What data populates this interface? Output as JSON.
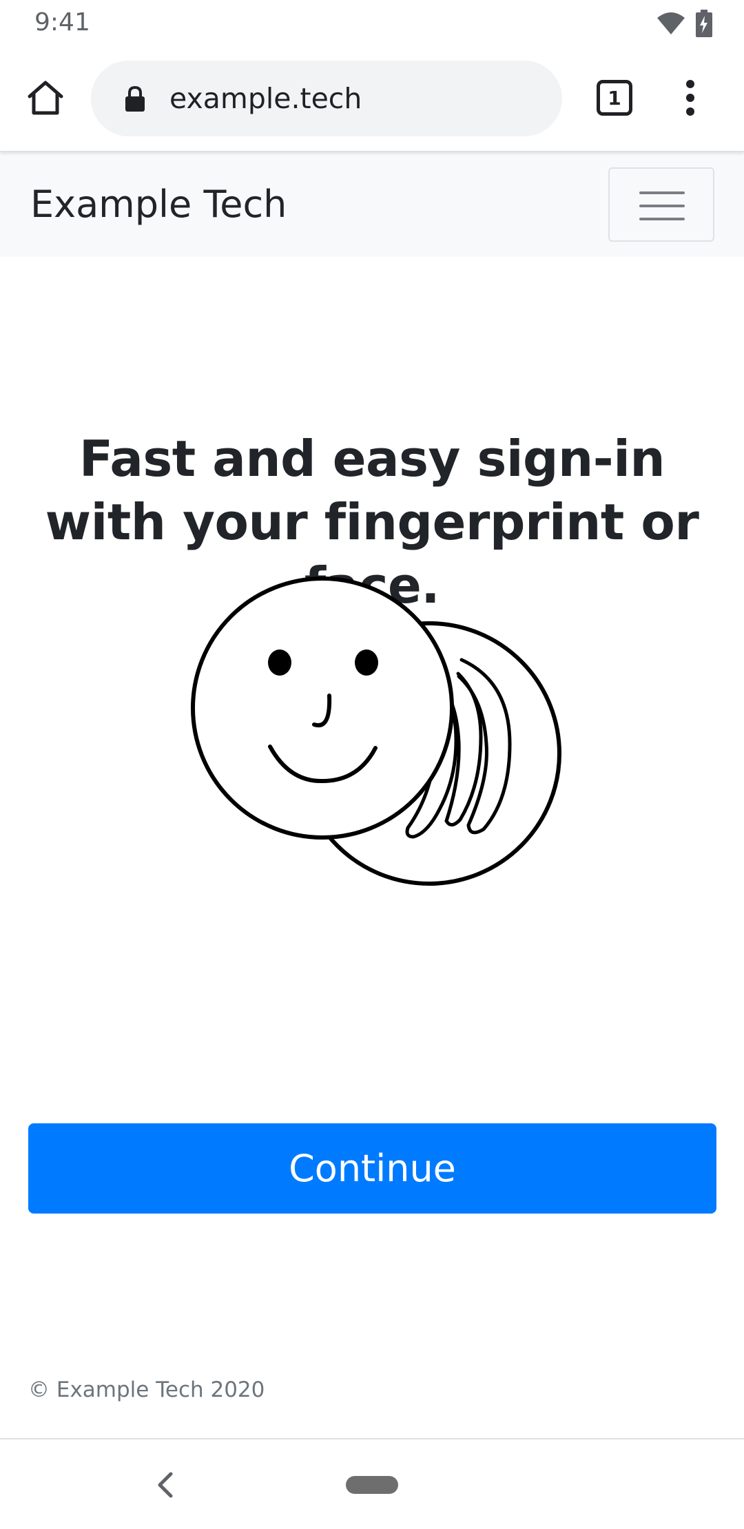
{
  "status_bar": {
    "time": "9:41",
    "icons": [
      "wifi-icon",
      "battery-icon"
    ]
  },
  "browser": {
    "url": "example.tech",
    "tab_count": "1",
    "icons": [
      "home-icon",
      "lock-icon",
      "more-vert-icon"
    ]
  },
  "navbar": {
    "brand": "Example Tech",
    "toggler_icon": "hamburger-icon"
  },
  "main": {
    "headline": "Fast and easy sign-in with your fingerprint or face.",
    "illustration": "face-and-fingerprint-illustration",
    "continue_label": "Continue"
  },
  "footer": {
    "copyright": "© Example Tech 2020"
  },
  "system_nav": {
    "icons": [
      "back-icon",
      "home-pill"
    ]
  },
  "colors": {
    "primary": "#007bff",
    "navbar_bg": "#f8f9fa",
    "url_bar_bg": "#f1f3f4",
    "text": "#212529",
    "muted": "#6c757d"
  }
}
